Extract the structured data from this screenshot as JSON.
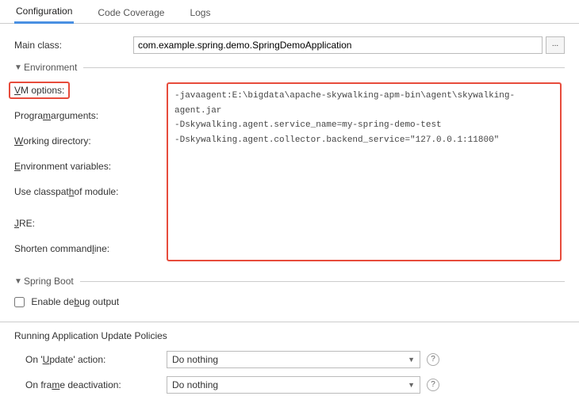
{
  "tabs": {
    "configuration": "Configuration",
    "codeCoverage": "Code Coverage",
    "logs": "Logs"
  },
  "mainClass": {
    "label": "Main class:",
    "value": "com.example.spring.demo.SpringDemoApplication",
    "browse": "..."
  },
  "environment": {
    "title": "Environment",
    "vmOptionsLabel": "VM options:",
    "vmOptionsValue": "-javaagent:E:\\bigdata\\apache-skywalking-apm-bin\\agent\\skywalking-agent.jar\n-Dskywalking.agent.service_name=my-spring-demo-test\n-Dskywalking.agent.collector.backend_service=\"127.0.0.1:11800\"",
    "programArgsLabel": "Program arguments:",
    "workingDirLabel": "Working directory:",
    "envVarsLabel": "Environment variables:",
    "classpathLabel": "Use classpath of module:",
    "jreLabel": "JRE:",
    "shortenCmdLabel": "Shorten command line:"
  },
  "springBoot": {
    "title": "Spring Boot",
    "enableDebug": "Enable debug output"
  },
  "policies": {
    "title": "Running Application Update Policies",
    "onUpdateLabel": "On 'Update' action:",
    "onUpdateValue": "Do nothing",
    "onFrameLabel": "On frame deactivation:",
    "onFrameValue": "Do nothing"
  }
}
